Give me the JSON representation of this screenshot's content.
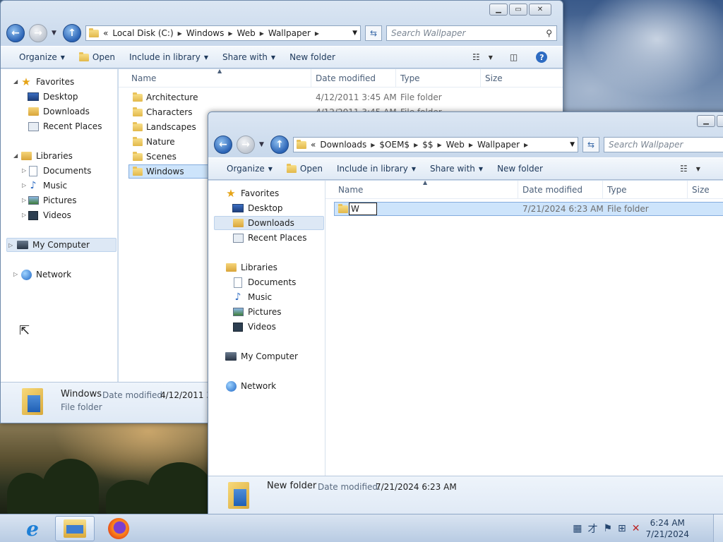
{
  "desktop": {},
  "back_window": {
    "address": {
      "prefix": "«",
      "crumbs": [
        "Local Disk (C:)",
        "Windows",
        "Web",
        "Wallpaper"
      ]
    },
    "search_placeholder": "Search Wallpaper",
    "toolbar": {
      "organize": "Organize",
      "open": "Open",
      "include_in_library": "Include in library",
      "share_with": "Share with",
      "new_folder": "New folder"
    },
    "nav": {
      "favorites": "Favorites",
      "desktop": "Desktop",
      "downloads": "Downloads",
      "recent_places": "Recent Places",
      "libraries": "Libraries",
      "documents": "Documents",
      "music": "Music",
      "pictures": "Pictures",
      "videos": "Videos",
      "my_computer": "My Computer",
      "network": "Network"
    },
    "columns": {
      "name": "Name",
      "date_modified": "Date modified",
      "type": "Type",
      "size": "Size"
    },
    "files": [
      {
        "name": "Architecture",
        "date": "4/12/2011 3:45 AM",
        "type": "File folder"
      },
      {
        "name": "Characters",
        "date": "4/12/2011 3:45 AM",
        "type": "File folder"
      },
      {
        "name": "Landscapes",
        "date": "",
        "type": ""
      },
      {
        "name": "Nature",
        "date": "",
        "type": ""
      },
      {
        "name": "Scenes",
        "date": "",
        "type": ""
      },
      {
        "name": "Windows",
        "date": "",
        "type": ""
      }
    ],
    "details": {
      "name": "Windows",
      "date_label": "Date modified:",
      "date_value": "4/12/2011 3:",
      "type": "File folder"
    }
  },
  "front_window": {
    "address": {
      "prefix": "«",
      "crumbs": [
        "Downloads",
        "$OEM$",
        "$$",
        "Web",
        "Wallpaper"
      ]
    },
    "search_placeholder": "Search Wallpaper",
    "toolbar": {
      "organize": "Organize",
      "open": "Open",
      "include_in_library": "Include in library",
      "share_with": "Share with",
      "new_folder": "New folder"
    },
    "nav": {
      "favorites": "Favorites",
      "desktop": "Desktop",
      "downloads": "Downloads",
      "recent_places": "Recent Places",
      "libraries": "Libraries",
      "documents": "Documents",
      "music": "Music",
      "pictures": "Pictures",
      "videos": "Videos",
      "my_computer": "My Computer",
      "network": "Network"
    },
    "columns": {
      "name": "Name",
      "date_modified": "Date modified",
      "type": "Type",
      "size": "Size"
    },
    "files": [
      {
        "rename_value": "W",
        "date": "7/21/2024 6:23 AM",
        "type": "File folder"
      }
    ],
    "details": {
      "name": "New folder",
      "date_label": "Date modified:",
      "date_value": "7/21/2024 6:23 AM"
    }
  },
  "taskbar": {
    "apps": [
      "internet-explorer",
      "windows-explorer",
      "firefox"
    ],
    "clock": {
      "time": "6:24 AM",
      "date": "7/21/2024"
    }
  }
}
